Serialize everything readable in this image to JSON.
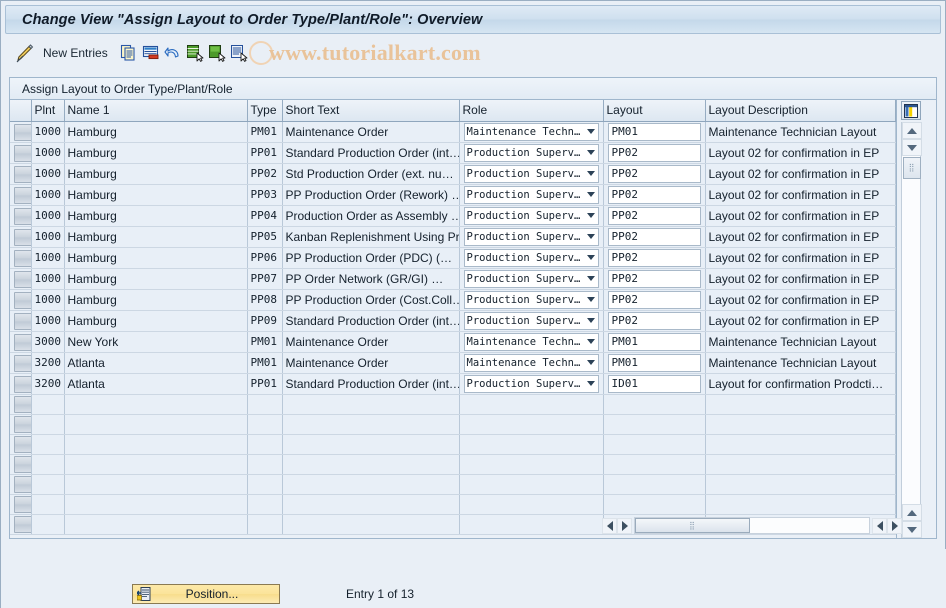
{
  "window": {
    "title": "Change View \"Assign Layout to Order Type/Plant/Role\": Overview"
  },
  "toolbar": {
    "display_change_icon": "pencil-icon",
    "new_entries_label": "New Entries",
    "icons": [
      "copy-icon",
      "delete-row-icon",
      "undo-icon",
      "select-layout-icon",
      "variant-icon",
      "print-variant-icon"
    ]
  },
  "watermark": {
    "text": "www.tutorialkart.com",
    "color": "#e9c39a"
  },
  "panel": {
    "header": "Assign Layout to Order Type/Plant/Role"
  },
  "table": {
    "columns": [
      "Plnt",
      "Name 1",
      "Type",
      "Short Text",
      "Role",
      "Layout",
      "Layout Description"
    ],
    "config_icon": "column-config-icon",
    "rows": [
      {
        "plnt": "1000",
        "name": "Hamburg",
        "type": "PM01",
        "short_text": "Maintenance Order",
        "role": "Maintenance Techn…",
        "layout": "PM01",
        "desc": "Maintenance Technician Layout"
      },
      {
        "plnt": "1000",
        "name": "Hamburg",
        "type": "PP01",
        "short_text": "Standard Production Order (int…",
        "role": "Production Superv…",
        "layout": "PP02",
        "desc": "Layout 02 for confirmation in EP"
      },
      {
        "plnt": "1000",
        "name": "Hamburg",
        "type": "PP02",
        "short_text": "Std Production Order (ext. nu…",
        "role": "Production Superv…",
        "layout": "PP02",
        "desc": "Layout 02 for confirmation in EP"
      },
      {
        "plnt": "1000",
        "name": "Hamburg",
        "type": "PP03",
        "short_text": "PP Production Order (Rework) …",
        "role": "Production Superv…",
        "layout": "PP02",
        "desc": "Layout 02 for confirmation in EP"
      },
      {
        "plnt": "1000",
        "name": "Hamburg",
        "type": "PP04",
        "short_text": "Production Order as Assembly …",
        "role": "Production Superv…",
        "layout": "PP02",
        "desc": "Layout 02 for confirmation in EP"
      },
      {
        "plnt": "1000",
        "name": "Hamburg",
        "type": "PP05",
        "short_text": "Kanban Replenishment Using Pr…",
        "role": "Production Superv…",
        "layout": "PP02",
        "desc": "Layout 02 for confirmation in EP"
      },
      {
        "plnt": "1000",
        "name": "Hamburg",
        "type": "PP06",
        "short_text": "PP Production Order (PDC)      (…",
        "role": "Production Superv…",
        "layout": "PP02",
        "desc": "Layout 02 for confirmation in EP"
      },
      {
        "plnt": "1000",
        "name": "Hamburg",
        "type": "PP07",
        "short_text": "PP Order Network      (GR/GI) …",
        "role": "Production Superv…",
        "layout": "PP02",
        "desc": "Layout 02 for confirmation in EP"
      },
      {
        "plnt": "1000",
        "name": "Hamburg",
        "type": "PP08",
        "short_text": "PP Production Order  (Cost.Coll…",
        "role": "Production Superv…",
        "layout": "PP02",
        "desc": "Layout 02 for confirmation in EP"
      },
      {
        "plnt": "1000",
        "name": "Hamburg",
        "type": "PP09",
        "short_text": "Standard Production Order (int…",
        "role": "Production Superv…",
        "layout": "PP02",
        "desc": "Layout 02 for confirmation in EP"
      },
      {
        "plnt": "3000",
        "name": "New York",
        "type": "PM01",
        "short_text": "Maintenance Order",
        "role": "Maintenance Techn…",
        "layout": "PM01",
        "desc": "Maintenance Technician Layout"
      },
      {
        "plnt": "3200",
        "name": "Atlanta",
        "type": "PM01",
        "short_text": "Maintenance Order",
        "role": "Maintenance Techn…",
        "layout": "PM01",
        "desc": "Maintenance Technician Layout"
      },
      {
        "plnt": "3200",
        "name": "Atlanta",
        "type": "PP01",
        "short_text": "Standard Production Order (int…",
        "role": "Production Superv…",
        "layout": "ID01",
        "desc": "Layout for confirmation Prodcti…"
      }
    ],
    "empty_row_count": 7
  },
  "footer": {
    "position_button": "Position...",
    "entry_status": "Entry 1 of 13"
  }
}
